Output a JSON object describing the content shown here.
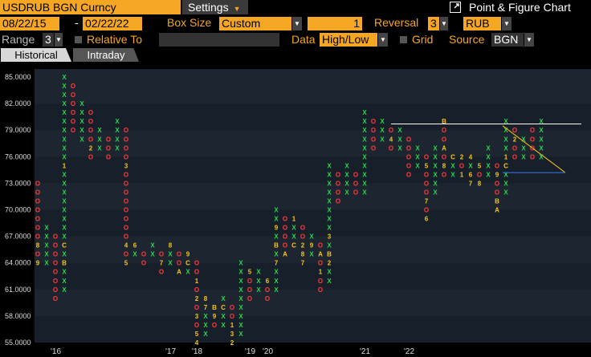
{
  "header": {
    "ticker": "USDRUB BGN Curncy",
    "settings_label": "Settings",
    "chart_title": "Point & Figure Chart",
    "external_icon": "external-link-icon"
  },
  "controls": {
    "start_date": "08/22/15",
    "end_date": "02/22/22",
    "date_separator": "-",
    "box_size_label": "Box Size",
    "box_size_value": "Custom",
    "box_value": "1",
    "reversal_label": "Reversal",
    "reversal_value": "3",
    "currency_value": "RUB",
    "range_label": "Range",
    "range_value": "3",
    "relative_to_label": "Relative To",
    "data_label": "Data",
    "data_value": "High/Low",
    "grid_label": "Grid",
    "source_label": "Source",
    "source_value": "BGN"
  },
  "tabs": [
    {
      "label": "Historical",
      "active": true
    },
    {
      "label": "Intraday",
      "active": false
    }
  ],
  "chart_data": {
    "type": "point-and-figure",
    "box_size": 1,
    "reversal": 3,
    "ylim": [
      55,
      86
    ],
    "y_ticks": [
      "85.0000",
      "82.0000",
      "79.0000",
      "76.0000",
      "73.0000",
      "70.0000",
      "67.0000",
      "64.0000",
      "61.0000",
      "58.0000",
      "55.0000"
    ],
    "y_tick_values": [
      85,
      82,
      79,
      76,
      73,
      70,
      67,
      64,
      61,
      58,
      55
    ],
    "x_labels": [
      {
        "label": "'16",
        "col": 2
      },
      {
        "label": "'17",
        "col": 15
      },
      {
        "label": "'18",
        "col": 18
      },
      {
        "label": "'19",
        "col": 24
      },
      {
        "label": "'20",
        "col": 26
      },
      {
        "label": "'21",
        "col": 37
      },
      {
        "label": "'22",
        "col": 42
      }
    ],
    "columns": [
      {
        "t": "O",
        "top": 73,
        "bot": 64,
        "m": {
          "66": "8",
          "64": "9"
        }
      },
      {
        "t": "X",
        "top": 68,
        "bot": 64
      },
      {
        "t": "O",
        "top": 67,
        "bot": 60
      },
      {
        "t": "X",
        "top": 85,
        "bot": 61,
        "m": {
          "75": "1",
          "66": "C",
          "64": "B"
        }
      },
      {
        "t": "O",
        "top": 84,
        "bot": 79
      },
      {
        "t": "X",
        "top": 82,
        "bot": 78
      },
      {
        "t": "O",
        "top": 81,
        "bot": 76,
        "m": {
          "77": "2"
        }
      },
      {
        "t": "X",
        "top": 79,
        "bot": 77
      },
      {
        "t": "O",
        "top": 78,
        "bot": 76
      },
      {
        "t": "X",
        "top": 80,
        "bot": 77
      },
      {
        "t": "O",
        "top": 79,
        "bot": 64,
        "m": {
          "75": "3",
          "66": "4",
          "64": "5"
        }
      },
      {
        "t": "X",
        "top": 66,
        "bot": 65,
        "m": {
          "66": "6"
        }
      },
      {
        "t": "O",
        "top": 65,
        "bot": 64
      },
      {
        "t": "X",
        "top": 66,
        "bot": 65
      },
      {
        "t": "O",
        "top": 65,
        "bot": 63,
        "m": {
          "64": "7"
        }
      },
      {
        "t": "X",
        "top": 66,
        "bot": 64,
        "m": {
          "66": "8"
        }
      },
      {
        "t": "O",
        "top": 65,
        "bot": 63,
        "m": {
          "63": "A"
        }
      },
      {
        "t": "X",
        "top": 65,
        "bot": 63,
        "m": {
          "65": "9",
          "64": "C"
        }
      },
      {
        "t": "O",
        "top": 64,
        "bot": 55,
        "m": {
          "62": "1",
          "60": "2",
          "58": "3",
          "56": "5",
          "55": "4"
        }
      },
      {
        "t": "X",
        "top": 60,
        "bot": 56,
        "m": {
          "60": "8",
          "59": "7",
          "57": "X"
        }
      },
      {
        "t": "O",
        "top": 59,
        "bot": 57,
        "m": {
          "59": "B",
          "58": "9"
        }
      },
      {
        "t": "X",
        "top": 60,
        "bot": 57,
        "m": {
          "59": "C"
        }
      },
      {
        "t": "O",
        "top": 59,
        "bot": 55,
        "m": {
          "57": "1",
          "56": "3",
          "55": "2"
        }
      },
      {
        "t": "X",
        "top": 64,
        "bot": 56
      },
      {
        "t": "O",
        "top": 63,
        "bot": 60,
        "m": {
          "63": "5"
        }
      },
      {
        "t": "X",
        "top": 63,
        "bot": 61,
        "m": {
          "63": "X"
        }
      },
      {
        "t": "O",
        "top": 62,
        "bot": 60,
        "m": {
          "62": "6"
        }
      },
      {
        "t": "X",
        "top": 70,
        "bot": 61,
        "m": {
          "68": "9",
          "66": "B",
          "64": "7"
        }
      },
      {
        "t": "O",
        "top": 69,
        "bot": 65,
        "m": {
          "65": "A"
        }
      },
      {
        "t": "X",
        "top": 69,
        "bot": 66,
        "m": {
          "69": "1",
          "67": "X",
          "66": "C"
        }
      },
      {
        "t": "O",
        "top": 68,
        "bot": 64,
        "m": {
          "66": "2",
          "65": "8",
          "64": "7"
        }
      },
      {
        "t": "X",
        "top": 67,
        "bot": 65,
        "m": {
          "66": "9"
        }
      },
      {
        "t": "O",
        "top": 66,
        "bot": 61,
        "m": {
          "65": "A",
          "63": "1"
        }
      },
      {
        "t": "X",
        "top": 75,
        "bot": 62,
        "m": {
          "67": "3",
          "65": "B",
          "64": "2"
        }
      },
      {
        "t": "O",
        "top": 74,
        "bot": 71
      },
      {
        "t": "X",
        "top": 75,
        "bot": 72
      },
      {
        "t": "O",
        "top": 74,
        "bot": 72
      },
      {
        "t": "X",
        "top": 81,
        "bot": 72
      },
      {
        "t": "O",
        "top": 80,
        "bot": 77
      },
      {
        "t": "X",
        "top": 80,
        "bot": 78
      },
      {
        "t": "O",
        "top": 79,
        "bot": 77,
        "m": {
          "78": "4"
        }
      },
      {
        "t": "X",
        "top": 79,
        "bot": 77
      },
      {
        "t": "O",
        "top": 78,
        "bot": 74
      },
      {
        "t": "X",
        "top": 77,
        "bot": 75
      },
      {
        "t": "O",
        "top": 76,
        "bot": 69,
        "m": {
          "75": "5",
          "71": "7",
          "69": "6"
        }
      },
      {
        "t": "X",
        "top": 77,
        "bot": 72,
        "m": {
          "77": "X"
        }
      },
      {
        "t": "O",
        "top": 80,
        "bot": 74,
        "m": {
          "80": "B",
          "77": "A",
          "75": "8"
        }
      },
      {
        "t": "X",
        "top": 76,
        "bot": 74,
        "m": {
          "76": "C"
        }
      },
      {
        "t": "O",
        "top": 76,
        "bot": 74,
        "m": {
          "76": "2",
          "74": "1"
        }
      },
      {
        "t": "X",
        "top": 76,
        "bot": 73,
        "m": {
          "76": "4",
          "74": "6",
          "73": "7"
        }
      },
      {
        "t": "O",
        "top": 75,
        "bot": 73,
        "m": {
          "75": "5",
          "73": "8"
        }
      },
      {
        "t": "X",
        "top": 77,
        "bot": 74
      },
      {
        "t": "O",
        "top": 75,
        "bot": 70,
        "m": {
          "74": "9",
          "71": "B",
          "70": "A"
        }
      },
      {
        "t": "X",
        "top": 80,
        "bot": 72,
        "m": {
          "76": "1",
          "75": "C"
        }
      },
      {
        "t": "O",
        "top": 79,
        "bot": 76,
        "m": {
          "78": "2"
        }
      },
      {
        "t": "X",
        "top": 78,
        "bot": 76
      },
      {
        "t": "O",
        "top": 79,
        "bot": 76
      },
      {
        "t": "X",
        "top": 80,
        "bot": 76
      }
    ],
    "trendline_level": 79.7,
    "overlays": [
      "horizontal-resistance-line",
      "yellow-triangle",
      "blue-support-line"
    ]
  }
}
